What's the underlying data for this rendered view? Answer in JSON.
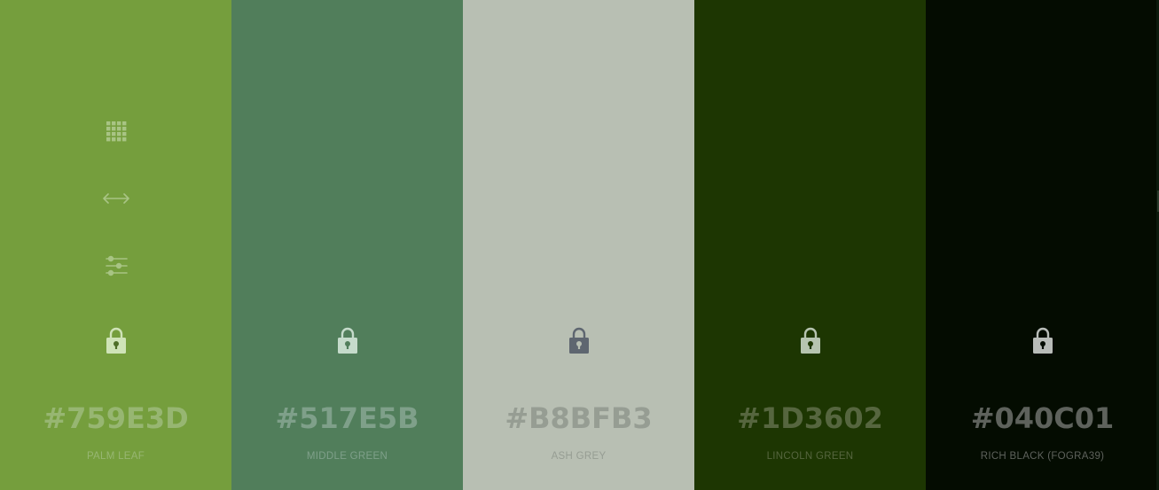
{
  "palette": {
    "colors": [
      {
        "hex": "#759E3D",
        "name": "PALM LEAF",
        "background": "#759E3D",
        "text_color": "#97B672",
        "lock_color": "#CFE3B8",
        "lock_hole_color": "#4E6E28"
      },
      {
        "hex": "#517E5B",
        "name": "MIDDLE GREEN",
        "background": "#517E5B",
        "text_color": "#7FA08A",
        "lock_color": "#C5DBCB",
        "lock_hole_color": "#517E5B"
      },
      {
        "hex": "#B8BFB3",
        "name": "ASH GREY",
        "background": "#B8BFB3",
        "text_color": "#969D93",
        "lock_color": "#5E6670",
        "lock_hole_color": "#B8BFB3"
      },
      {
        "hex": "#1D3602",
        "name": "LINCOLN GREEN",
        "background": "#1D3602",
        "text_color": "#56663F",
        "lock_color": "#B6C4B0",
        "lock_hole_color": "#1D3602"
      },
      {
        "hex": "#040C01",
        "name": "RICH BLACK (FOGRA39)",
        "background": "#040C01",
        "text_color": "#5E625C",
        "lock_color": "#B8BCB8",
        "lock_hole_color": "#040C01"
      }
    ]
  },
  "tools": {
    "icon_color": "#A8C484",
    "items": [
      {
        "icon": "grid-icon"
      },
      {
        "icon": "arrows-horizontal-icon"
      },
      {
        "icon": "sliders-icon"
      }
    ]
  }
}
